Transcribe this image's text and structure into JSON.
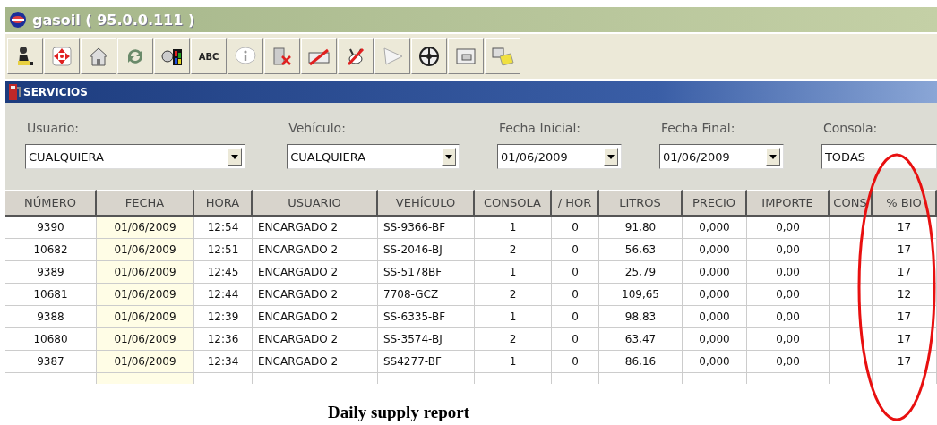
{
  "window": {
    "title": "gasoil ( 95.0.0.111 )"
  },
  "toolbar": [
    {
      "kind": "person"
    },
    {
      "kind": "move"
    },
    {
      "kind": "home"
    },
    {
      "kind": "refresh"
    },
    {
      "kind": "figure"
    },
    {
      "kind": "text",
      "label": "ABC"
    },
    {
      "kind": "info"
    },
    {
      "kind": "delete-pc"
    },
    {
      "kind": "no-card"
    },
    {
      "kind": "no-animal"
    },
    {
      "kind": "triangle"
    },
    {
      "kind": "target"
    },
    {
      "kind": "window"
    },
    {
      "kind": "notes"
    }
  ],
  "section": {
    "title": "SERVICIOS"
  },
  "filters": [
    {
      "label": "Usuario:",
      "value": "CUALQUIERA",
      "arrow": true
    },
    {
      "label": "Vehículo:",
      "value": "CUALQUIERA",
      "arrow": true
    },
    {
      "label": "Fecha Inicial:",
      "value": "01/06/2009",
      "arrow": true
    },
    {
      "label": "Fecha Final:",
      "value": "01/06/2009",
      "arrow": true
    },
    {
      "label": "Consola:",
      "value": "TODAS",
      "arrow": false
    }
  ],
  "table": {
    "columns": [
      "NÚMERO",
      "FECHA",
      "HORA",
      "USUARIO",
      "VEHÍCULO",
      "CONSOLA",
      "/ HOR",
      "LITROS",
      "PRECIO",
      "IMPORTE",
      "CONS",
      "% BIO"
    ],
    "rows": [
      [
        "9390",
        "01/06/2009",
        "12:54",
        "ENCARGADO 2",
        "SS-9366-BF",
        "1",
        "0",
        "91,80",
        "0,000",
        "0,00",
        "",
        "17"
      ],
      [
        "10682",
        "01/06/2009",
        "12:51",
        "ENCARGADO 2",
        "SS-2046-BJ",
        "2",
        "0",
        "56,63",
        "0,000",
        "0,00",
        "",
        "17"
      ],
      [
        "9389",
        "01/06/2009",
        "12:45",
        "ENCARGADO 2",
        "SS-5178BF",
        "1",
        "0",
        "25,79",
        "0,000",
        "0,00",
        "",
        "17"
      ],
      [
        "10681",
        "01/06/2009",
        "12:44",
        "ENCARGADO 2",
        "7708-GCZ",
        "2",
        "0",
        "109,65",
        "0,000",
        "0,00",
        "",
        "12"
      ],
      [
        "9388",
        "01/06/2009",
        "12:39",
        "ENCARGADO 2",
        "SS-6335-BF",
        "1",
        "0",
        "98,83",
        "0,000",
        "0,00",
        "",
        "17"
      ],
      [
        "10680",
        "01/06/2009",
        "12:36",
        "ENCARGADO 2",
        "SS-3574-BJ",
        "2",
        "0",
        "63,47",
        "0,000",
        "0,00",
        "",
        "17"
      ],
      [
        "9387",
        "01/06/2009",
        "12:34",
        "ENCARGADO 2",
        "SS4277-BF",
        "1",
        "0",
        "86,16",
        "0,000",
        "0,00",
        "",
        "17"
      ]
    ]
  },
  "caption": "Daily supply report"
}
